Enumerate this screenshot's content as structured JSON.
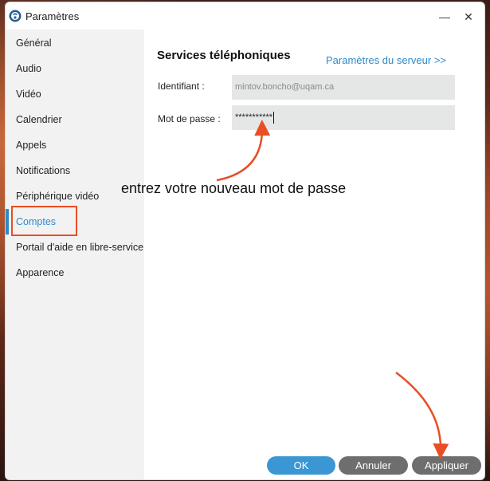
{
  "window": {
    "title": "Paramètres",
    "minimize_symbol": "—",
    "close_symbol": "✕"
  },
  "sidebar": {
    "items": [
      {
        "label": "Général"
      },
      {
        "label": "Audio"
      },
      {
        "label": "Vidéo"
      },
      {
        "label": "Calendrier"
      },
      {
        "label": "Appels"
      },
      {
        "label": "Notifications"
      },
      {
        "label": "Périphérique vidéo"
      },
      {
        "label": "Comptes",
        "active": true
      },
      {
        "label": "Portail d'aide en libre-service"
      },
      {
        "label": "Apparence"
      }
    ]
  },
  "main": {
    "section_title": "Services téléphoniques",
    "server_link": "Paramètres du serveur >>",
    "identifier_label": "Identifiant :",
    "identifier_value": "mintov.boncho@uqam.ca",
    "password_label": "Mot de passe :",
    "password_value": "***********"
  },
  "annotation": {
    "text": "entrez votre nouveau mot de passe",
    "arrow_color": "#e94e25"
  },
  "buttons": {
    "ok": "OK",
    "cancel": "Annuler",
    "apply": "Appliquer"
  },
  "colors": {
    "accent": "#2f8ac9",
    "ok_button": "#3a97d4",
    "secondary_button": "#6e6e6e",
    "highlight": "#e94e25"
  }
}
